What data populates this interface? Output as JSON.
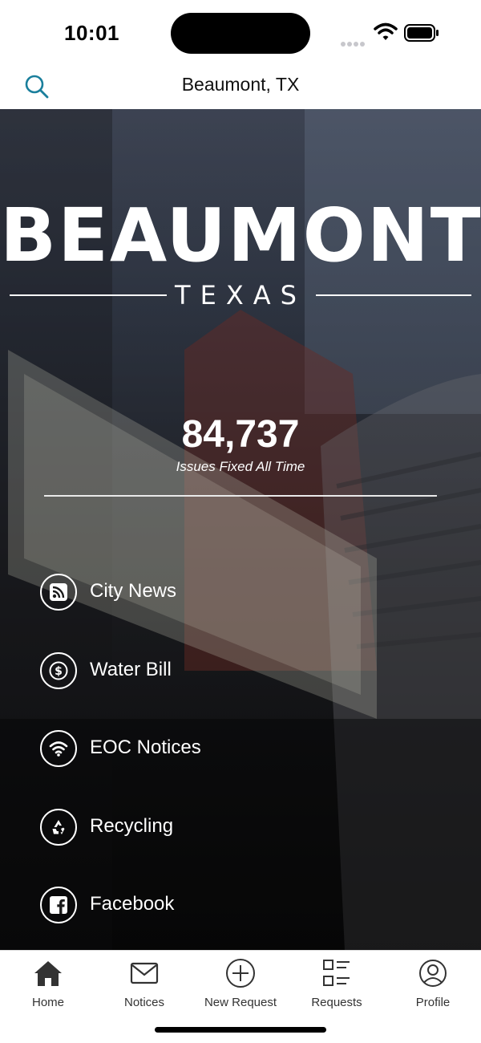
{
  "status_bar": {
    "time": "10:01"
  },
  "header": {
    "title": "Beaumont, TX",
    "search_icon": "search-icon"
  },
  "hero": {
    "logo_word": "BEAUMONT",
    "logo_sub": "TEXAS",
    "stat_value": "84,737",
    "stat_label": "Issues Fixed All Time"
  },
  "links": [
    {
      "label": "City News",
      "icon": "rss-icon"
    },
    {
      "label": "Water Bill",
      "icon": "dollar-icon"
    },
    {
      "label": "EOC Notices",
      "icon": "wifi-icon"
    },
    {
      "label": "Recycling",
      "icon": "recycle-icon"
    },
    {
      "label": "Facebook",
      "icon": "facebook-icon"
    }
  ],
  "tabs": [
    {
      "label": "Home",
      "icon": "home-icon",
      "active": true
    },
    {
      "label": "Notices",
      "icon": "envelope-icon"
    },
    {
      "label": "New Request",
      "icon": "plus-circle-icon"
    },
    {
      "label": "Requests",
      "icon": "list-icon"
    },
    {
      "label": "Profile",
      "icon": "person-icon"
    }
  ],
  "colors": {
    "accent": "#1a7f9c",
    "tab_active": "#333333",
    "hero_overlay": "#0b0b0d"
  }
}
